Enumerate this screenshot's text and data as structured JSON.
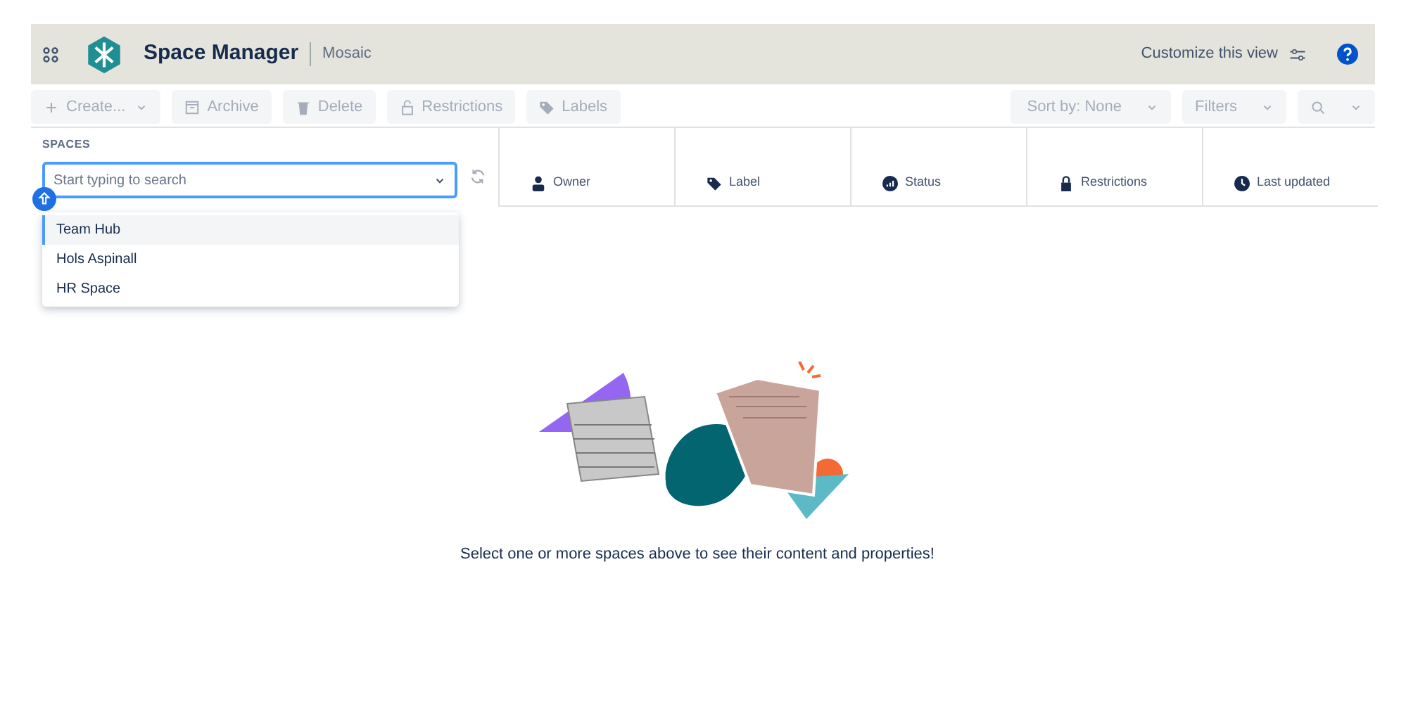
{
  "header": {
    "title": "Space Manager",
    "subtitle": "Mosaic",
    "customize": "Customize this view"
  },
  "toolbar": {
    "left": [
      {
        "label": "Create...",
        "kind": "create",
        "disabled": true
      },
      {
        "label": "Archive",
        "kind": "archive",
        "disabled": true
      },
      {
        "label": "Delete",
        "kind": "delete",
        "disabled": true
      },
      {
        "label": "Restrictions",
        "kind": "restrictions",
        "disabled": true
      },
      {
        "label": "Labels",
        "kind": "labels",
        "disabled": true
      }
    ],
    "right": [
      {
        "label": "Sort by: None",
        "kind": "sort",
        "disabled": true
      },
      {
        "label": "Filters",
        "kind": "filters",
        "disabled": true
      },
      {
        "kind": "search",
        "disabled": true
      }
    ]
  },
  "spaces": {
    "label": "SPACES",
    "placeholder": "Start typing to search",
    "options": [
      {
        "label": "Team Hub",
        "selected": true
      },
      {
        "label": "Hols Aspinall",
        "selected": false
      },
      {
        "label": "HR Space",
        "selected": false
      }
    ]
  },
  "table": {
    "columns": [
      {
        "label": "Owner",
        "kind": "owner"
      },
      {
        "label": "Label",
        "kind": "label"
      },
      {
        "label": "Status",
        "kind": "status"
      },
      {
        "label": "Restrictions",
        "kind": "restrictions"
      },
      {
        "label": "Last updated",
        "kind": "updated"
      }
    ]
  },
  "empty_message": "Select one or more spaces above to see their content and properties!"
}
